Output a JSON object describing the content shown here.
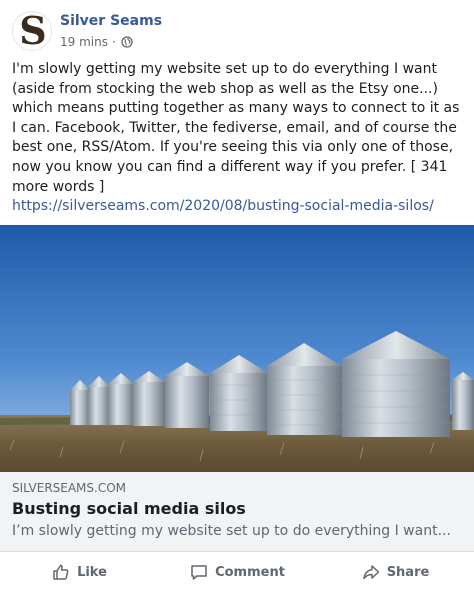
{
  "post": {
    "author": "Silver Seams",
    "avatar_letter": "S",
    "time": "19 mins",
    "separator": "·",
    "audience_icon": "globe-icon",
    "body": "I'm slowly getting my website set up to do everything I want (aside from stocking the web shop as well as the Etsy one...) which means putting together as many ways to connect to it as I can. Facebook, Twitter, the fediverse, email, and of course the best one, RSS/Atom. If you're seeing this via only one of those, now you know you can find a different way if you prefer. [ 341 more words ]",
    "link": "https://silverseams.com/2020/08/busting-social-media-silos/"
  },
  "link_preview": {
    "domain": "SILVERSEAMS.COM",
    "title": "Busting social media silos",
    "description": "I’m slowly getting my website set up to do everything I want..."
  },
  "actions": {
    "like_label": "Like",
    "comment_label": "Comment",
    "share_label": "Share"
  },
  "colors": {
    "link_blue": "#385898",
    "muted": "#606770",
    "card_bg": "#f2f3f5"
  }
}
